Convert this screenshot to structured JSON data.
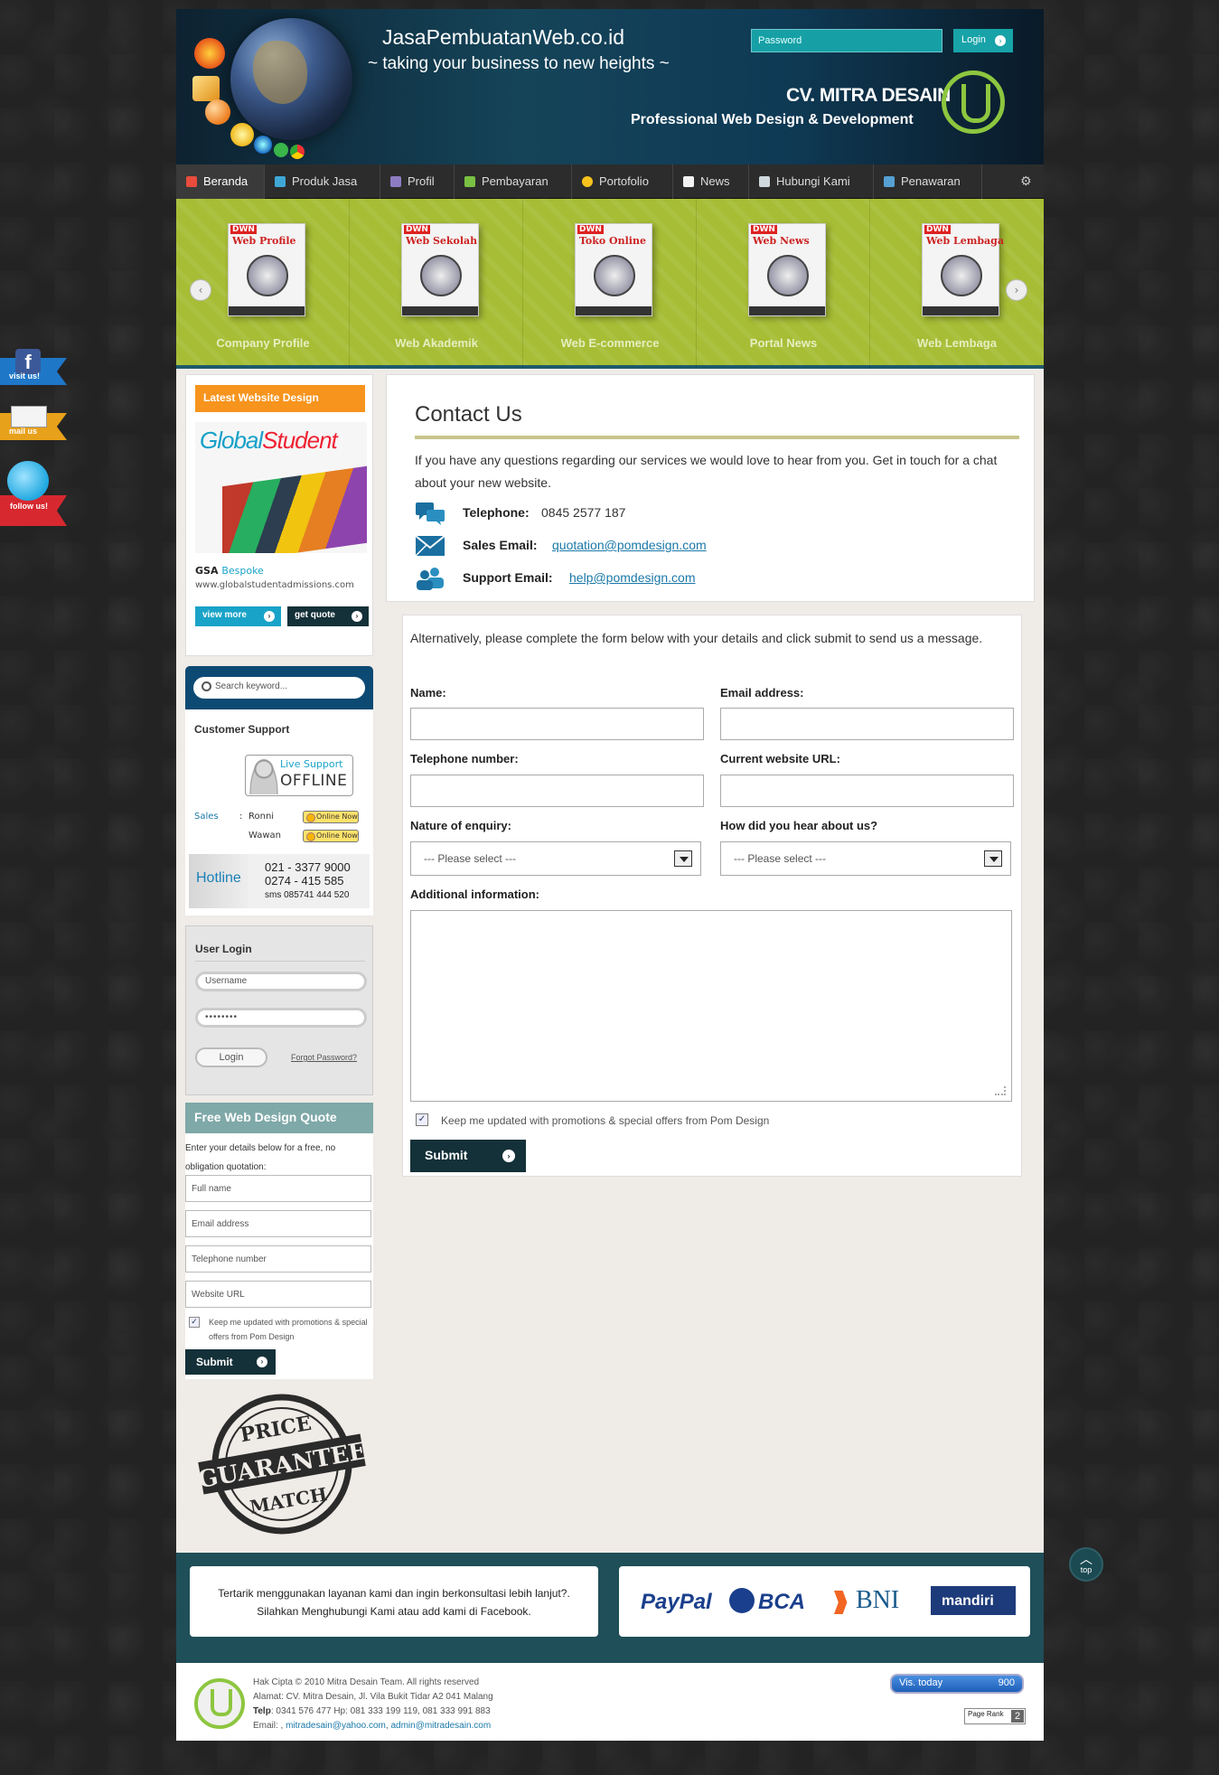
{
  "header": {
    "site_title": "JasaPembuatanWeb.co.id",
    "tagline": "~ taking your business to new heights ~",
    "password_placeholder": "Password",
    "login_label": "Login",
    "company": "CV. MITRA DESAIN",
    "company_sub": "Professional Web Design & Development"
  },
  "nav": {
    "items": [
      {
        "label": "Beranda",
        "color": "#e74c3c"
      },
      {
        "label": "Produk Jasa",
        "color": "#3fa7d6"
      },
      {
        "label": "Profil",
        "color": "#8e7cc3"
      },
      {
        "label": "Pembayaran",
        "color": "#7ac143"
      },
      {
        "label": "Portofolio",
        "color": "#f7c21d"
      },
      {
        "label": "News",
        "color": "#f2f2f2"
      },
      {
        "label": "Hubungi Kami",
        "color": "#cfd8dc"
      },
      {
        "label": "Penawaran",
        "color": "#56a0d3"
      }
    ]
  },
  "slider": {
    "items": [
      {
        "box_title": "Web Profile",
        "label": "Company Profile"
      },
      {
        "box_title": "Web Sekolah",
        "label": "Web Akademik"
      },
      {
        "box_title": "Toko Online",
        "label": "Web E-commerce"
      },
      {
        "box_title": "Web News",
        "label": "Portal News"
      },
      {
        "box_title": "Web Lembaga",
        "label": "Web Lembaga"
      }
    ],
    "box_tag": "DWN"
  },
  "social": {
    "facebook": "visit us!",
    "mail": "mail us",
    "twitter": "follow us!"
  },
  "latest": {
    "heading": "Latest Website Design",
    "logo_text_1": "Global",
    "logo_text_2": "Student",
    "name_bold": "GSA",
    "name_link": "Bespoke",
    "url": "www.globalstudentadmissions.com",
    "view_more": "view more",
    "get_quote": "get quote"
  },
  "search": {
    "placeholder": "Search keyword..."
  },
  "support": {
    "title": "Customer Support",
    "live_1": "Live Support",
    "live_2": "OFFLINE",
    "sales_label": "Sales",
    "sep": ":",
    "person_1": "Ronni",
    "person_2": "Wawan",
    "online_label": "Online Now",
    "hotline_label": "Hotline",
    "phone_1": "021 - 3377 9000",
    "phone_2": "0274  -  415 585",
    "sms": "sms 085741 444 520"
  },
  "user_login": {
    "title": "User Login",
    "username_placeholder": "Username",
    "password_value": "••••••••",
    "login": "Login",
    "forgot": "Forgot Password?"
  },
  "free_quote": {
    "heading": "Free Web Design Quote",
    "intro": "Enter your details below for a free, no obligation quotation:",
    "full_name": "Full name",
    "email": "Email address",
    "phone": "Telephone number",
    "url": "Website URL",
    "keep_updated": "Keep me updated with promotions & special offers from Pom Design",
    "submit": "Submit"
  },
  "stamp": {
    "top": "PRICE",
    "middle": "GUARANTEE",
    "bottom": "MATCH"
  },
  "contact": {
    "title": "Contact Us",
    "intro": "If you have any questions regarding our services we would love to hear from you. Get in touch for a chat about your new website.",
    "telephone_label": "Telephone:",
    "telephone_value": "0845 2577 187",
    "sales_label": "Sales Email:",
    "sales_value": "quotation@pomdesign.com",
    "support_label": "Support Email:",
    "support_value": "help@pomdesign.com"
  },
  "form": {
    "intro": "Alternatively, please complete the form below with your details and click submit to send us a message.",
    "name": "Name:",
    "email": "Email address:",
    "telephone": "Telephone number:",
    "website": "Current website URL:",
    "nature": "Nature of enquiry:",
    "hear": "How did you hear about us?",
    "select_placeholder": "--- Please select ---",
    "additional": "Additional information:",
    "keep_updated": "Keep me updated with promotions & special offers from Pom Design",
    "submit": "Submit"
  },
  "footer": {
    "cta_1": "Tertarik menggunakan layanan kami dan ingin berkonsultasi lebih lanjut?.",
    "cta_2": "Silahkan Menghubungi Kami atau add kami di Facebook.",
    "paypal": "PayPal",
    "bca": "BCA",
    "bni": "BNI",
    "mandiri": "mandiri",
    "copyright": "Hak Cipta © 2010 Mitra Desain Team. All rights reserved",
    "address": "Alamat: CV. Mitra Desain, Jl. Vila Bukit Tidar A2 041 Malang",
    "telp_label": "Telp",
    "telp": ": 0341 576 477 Hp: 081 333 199 119, 081 333 991 883",
    "email_label": "Email: ,",
    "email_1": "mitradesain@yahoo.com",
    "email_sep": ",",
    "email_2": "admin@mitradesain.com",
    "visitors_label": "Vis. today",
    "visitors_value": "900",
    "pagerank_label": "Page Rank",
    "pagerank_value": "2",
    "top": "top"
  }
}
